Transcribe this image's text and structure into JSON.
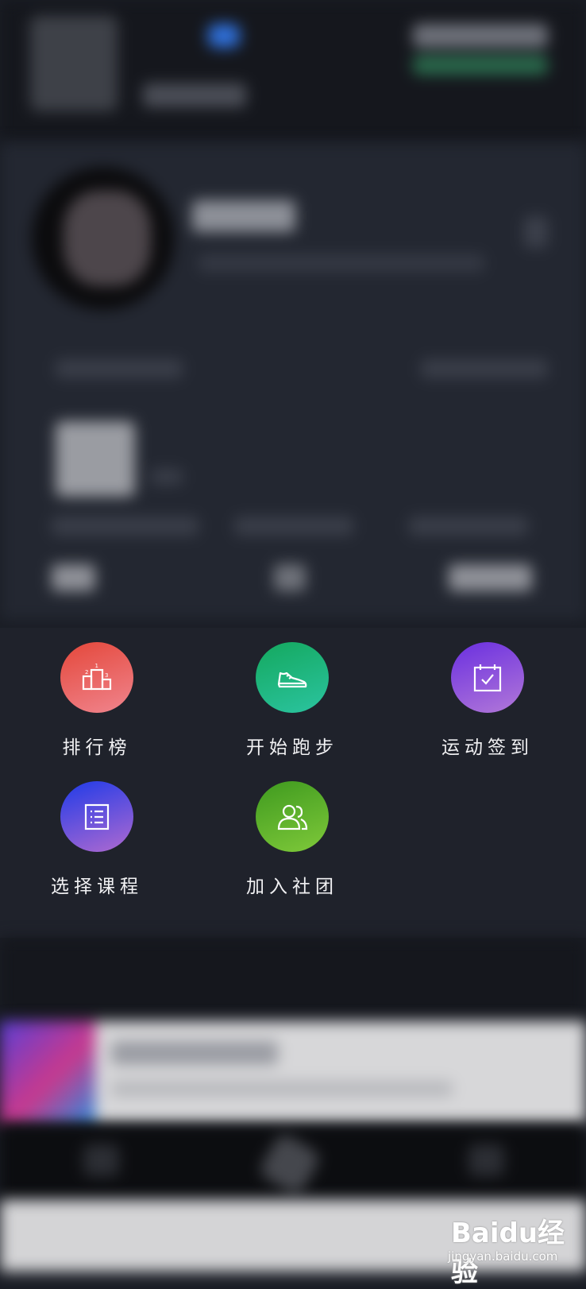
{
  "menu": {
    "items": [
      {
        "label": "排行榜",
        "icon": "podium-icon",
        "color_from": "#e4473a",
        "color_to": "#f0858e"
      },
      {
        "label": "开始跑步",
        "icon": "running-shoe-icon",
        "color_from": "#14a85e",
        "color_to": "#2bc4a0"
      },
      {
        "label": "运动签到",
        "icon": "calendar-check-icon",
        "color_from": "#6a2fe0",
        "color_to": "#b278d8"
      },
      {
        "label": "选择课程",
        "icon": "course-list-icon",
        "color_from": "#1f3be8",
        "color_to": "#b06ad0"
      },
      {
        "label": "加入社团",
        "icon": "group-users-icon",
        "color_from": "#3f9a1f",
        "color_to": "#7fc93a"
      }
    ]
  },
  "watermark": {
    "brand": "Baidu经验",
    "url": "jingyan.baidu.com"
  },
  "colors": {
    "background": "#1a1d25",
    "panel": "#1f222b",
    "label": "#f1f1f3"
  }
}
